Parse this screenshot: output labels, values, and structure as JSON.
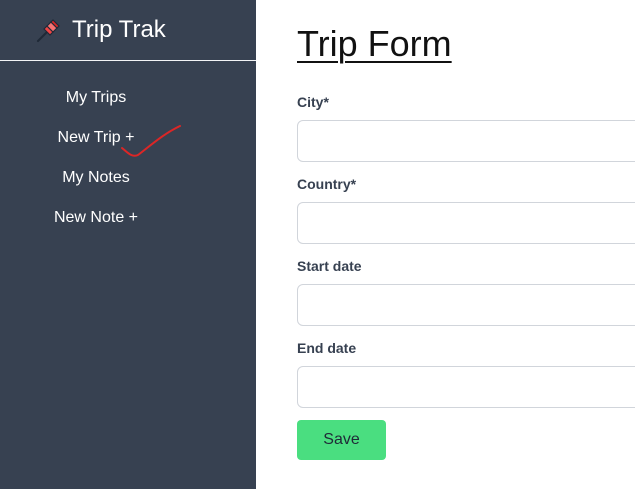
{
  "brand": {
    "title": "Trip Trak",
    "icon": "pushpin-icon"
  },
  "sidebar": {
    "items": [
      {
        "label": "My Trips"
      },
      {
        "label": "New Trip +"
      },
      {
        "label": "My Notes"
      },
      {
        "label": "New Note +"
      }
    ]
  },
  "main": {
    "title": "Trip Form",
    "fields": [
      {
        "label": "City*",
        "value": ""
      },
      {
        "label": "Country*",
        "value": ""
      },
      {
        "label": "Start date",
        "value": ""
      },
      {
        "label": "End date",
        "value": ""
      }
    ],
    "save_label": "Save"
  },
  "colors": {
    "sidebar_bg": "#374151",
    "save_button": "#4ade80",
    "annotation_mark": "#dc2626"
  }
}
